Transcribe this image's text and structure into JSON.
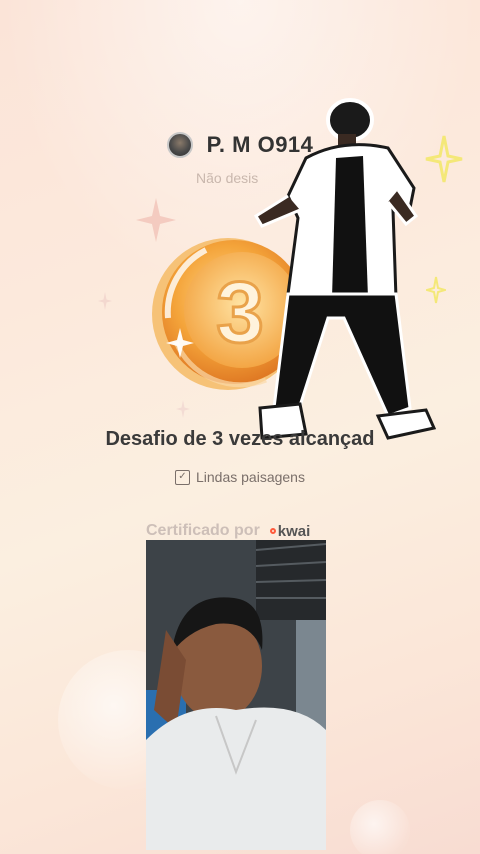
{
  "header": {
    "username": "P. M O914",
    "subtitle": "Não desis"
  },
  "achievement": {
    "medal_number": "3",
    "title": "Desafio de 3 vezes alcançad",
    "task_label": "Lindas paisagens"
  },
  "certification": {
    "label": "Certificado por",
    "brand": "kwai"
  },
  "colors": {
    "medal": "#f0a23a",
    "accent": "#ff5a3c",
    "sparkle": "#f7e98a"
  }
}
